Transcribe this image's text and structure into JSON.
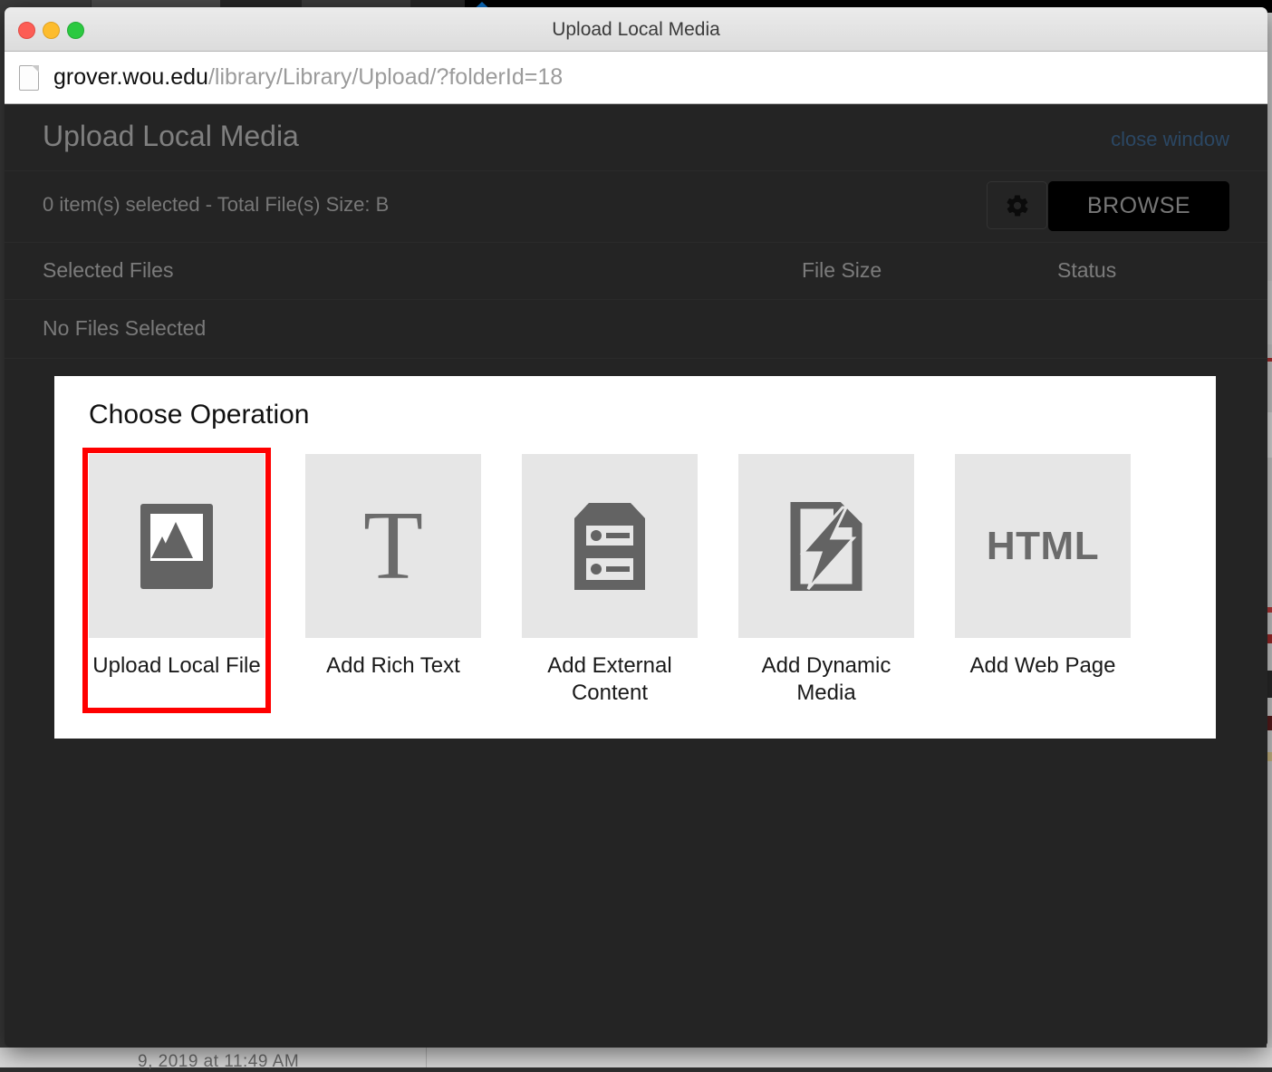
{
  "window": {
    "title": "Upload Local Media",
    "traffic_lights": [
      {
        "name": "close-button",
        "color": "#fc5d55"
      },
      {
        "name": "minimize-button",
        "color": "#fdbc2d"
      },
      {
        "name": "zoom-button",
        "color": "#2bc940"
      }
    ]
  },
  "url_bar": {
    "icon": "page-icon",
    "host": "grover.wou.edu",
    "path": "/library/Library/Upload/?folderId=18"
  },
  "app": {
    "title": "Upload Local Media",
    "close_link": "close window",
    "selection_summary": "0 item(s) selected - Total File(s) Size: B",
    "settings_icon": "gear-icon",
    "browse_label": "BROWSE",
    "table": {
      "columns": [
        "Selected Files",
        "File Size",
        "Status"
      ],
      "rows": [
        {
          "name": "No Files Selected",
          "size": "",
          "status": ""
        }
      ]
    }
  },
  "modal": {
    "title": "Choose Operation",
    "highlight_color": "#ff0000",
    "operations": [
      {
        "label": "Upload Local File",
        "icon": "image-icon",
        "highlighted": true
      },
      {
        "label": "Add Rich Text",
        "icon": "serif-t-icon",
        "highlighted": false
      },
      {
        "label": "Add External Content",
        "icon": "server-rack-icon",
        "highlighted": false
      },
      {
        "label": "Add Dynamic Media",
        "icon": "document-bolt-icon",
        "highlighted": false
      },
      {
        "label": "Add Web Page",
        "icon": "html-icon",
        "highlighted": false
      }
    ]
  },
  "background": {
    "bottom_text": "9, 2019 at 11:49 AM"
  }
}
